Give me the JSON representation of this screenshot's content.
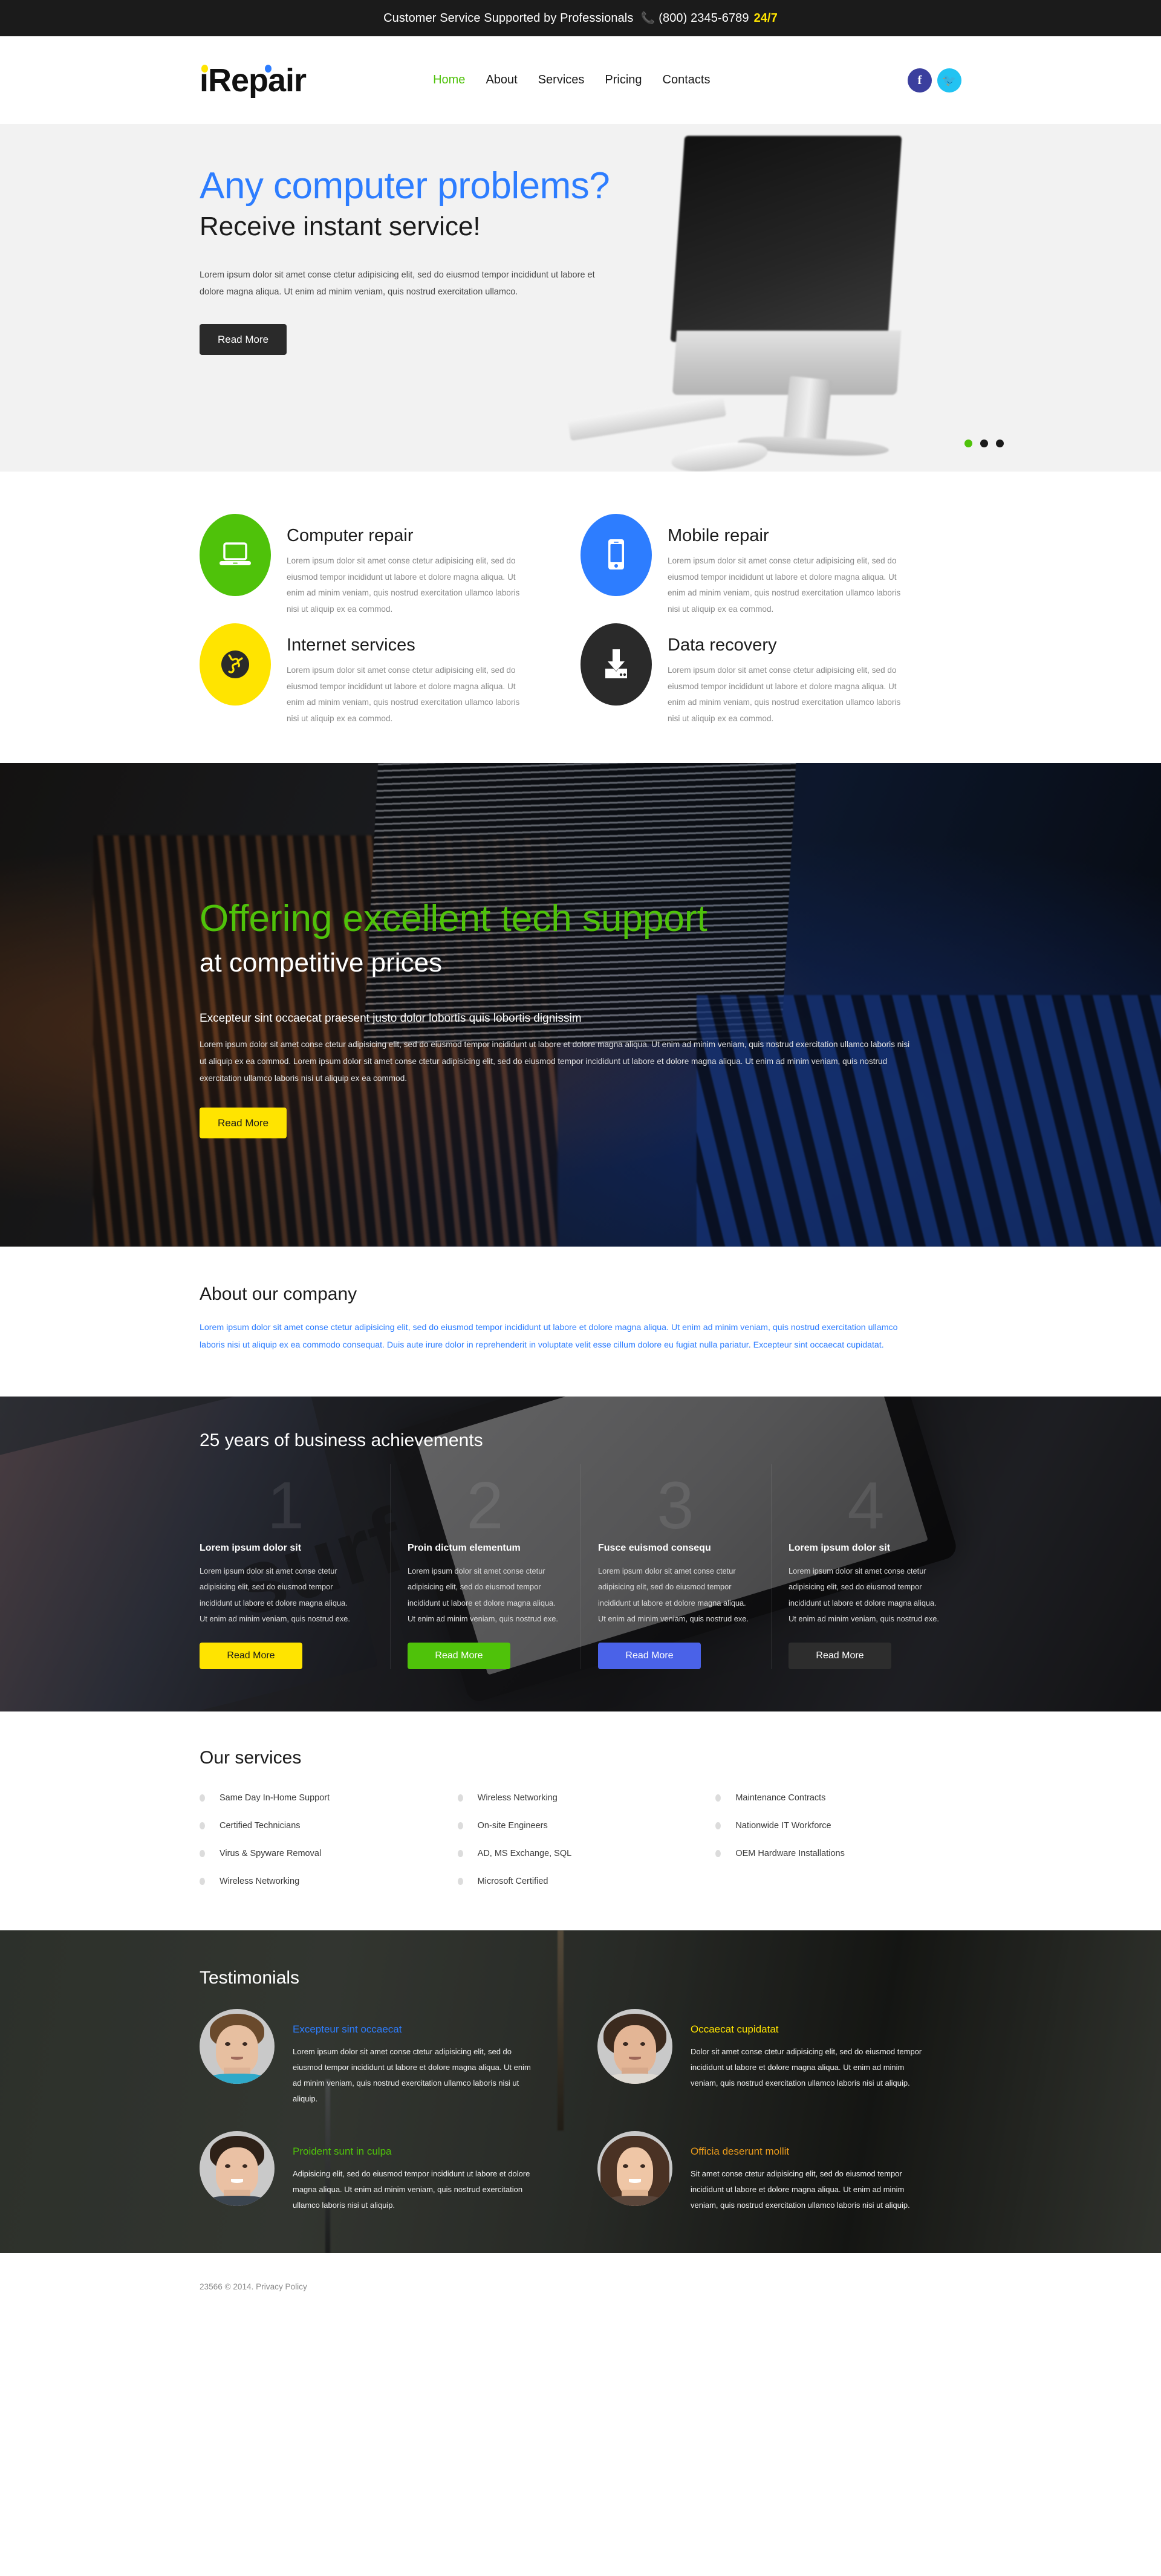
{
  "topbar": {
    "text": "Customer Service Supported by Professionals",
    "phone_icon": "phone-icon",
    "phone": "(800) 2345-6789",
    "badge": "24/7"
  },
  "header": {
    "logo": "iRepair",
    "nav": [
      {
        "label": "Home",
        "active": true
      },
      {
        "label": "About",
        "active": false
      },
      {
        "label": "Services",
        "active": false
      },
      {
        "label": "Pricing",
        "active": false
      },
      {
        "label": "Contacts",
        "active": false
      }
    ],
    "socials": [
      {
        "name": "facebook-icon",
        "glyph": "f"
      },
      {
        "name": "twitter-icon",
        "glyph": "🐦"
      }
    ]
  },
  "hero": {
    "title": "Any computer problems?",
    "subtitle": "Receive instant service!",
    "paragraph": "Lorem ipsum dolor sit amet conse ctetur adipisicing elit, sed do eiusmod tempor incididunt ut labore et dolore magna aliqua. Ut enim ad minim veniam, quis nostrud exercitation ullamco.",
    "button": "Read More",
    "dots_total": 3,
    "dot_active_index": 0
  },
  "features": [
    {
      "icon": "laptop-icon",
      "color": "#4fc20a",
      "title": "Computer repair",
      "text": "Lorem ipsum dolor sit amet conse ctetur adipisicing elit, sed do eiusmod tempor incididunt ut labore et dolore magna aliqua. Ut enim ad minim veniam, quis nostrud exercitation ullamco laboris nisi ut aliquip ex ea commod."
    },
    {
      "icon": "smartphone-icon",
      "color": "#2d7dff",
      "title": "Mobile repair",
      "text": "Lorem ipsum dolor sit amet conse ctetur adipisicing elit, sed do eiusmod tempor incididunt ut labore et dolore magna aliqua. Ut enim ad minim veniam, quis nostrud exercitation ullamco laboris nisi ut aliquip ex ea commod."
    },
    {
      "icon": "globe-icon",
      "color": "#ffe400",
      "title": "Internet services",
      "text": "Lorem ipsum dolor sit amet conse ctetur adipisicing elit, sed do eiusmod tempor incididunt ut labore et dolore magna aliqua. Ut enim ad minim veniam, quis nostrud exercitation ullamco laboris nisi ut aliquip ex ea commod."
    },
    {
      "icon": "download-box-icon",
      "color": "#2a2a2a",
      "title": "Data recovery",
      "text": "Lorem ipsum dolor sit amet conse ctetur adipisicing elit, sed do eiusmod tempor incididunt ut labore et dolore magna aliqua. Ut enim ad minim veniam, quis nostrud exercitation ullamco laboris nisi ut aliquip ex ea commod."
    }
  ],
  "promo": {
    "title": "Offering excellent tech support",
    "subtitle": "at competitive prices",
    "lead": "Excepteur sint occaecat praesent justo dolor lobortis quis lobortis dignissim",
    "paragraph": "Lorem ipsum dolor sit amet conse ctetur adipisicing elit, sed do eiusmod tempor incididunt ut labore et dolore magna aliqua. Ut enim ad minim veniam, quis nostrud exercitation ullamco laboris nisi ut aliquip ex ea commod. Lorem ipsum dolor sit amet conse ctetur adipisicing elit, sed do eiusmod tempor incididunt ut labore et dolore magna aliqua. Ut enim ad minim veniam, quis nostrud exercitation ullamco laboris nisi ut aliquip ex ea commod.",
    "button": "Read More"
  },
  "about": {
    "title": "About our company",
    "paragraph": "Lorem ipsum dolor sit amet conse ctetur adipisicing elit, sed do eiusmod tempor incididunt ut labore et dolore magna aliqua. Ut enim ad minim veniam, quis nostrud exercitation ullamco laboris nisi ut aliquip ex ea commodo consequat. Duis aute irure dolor in reprehenderit in voluptate velit esse cillum dolore eu fugiat nulla pariatur. Excepteur sint occaecat cupidatat."
  },
  "achievements": {
    "title": "25 years of business achievements",
    "watermark": "surf",
    "cards": [
      {
        "number": "1",
        "title": "Lorem ipsum dolor sit",
        "text": "Lorem ipsum dolor sit amet conse ctetur adipisicing elit, sed do eiusmod tempor incididunt ut labore et dolore magna aliqua. Ut enim ad minim veniam, quis nostrud exe.",
        "button": "Read More",
        "button_color": "#ffe400"
      },
      {
        "number": "2",
        "title": "Proin dictum elementum",
        "text": "Lorem ipsum dolor sit amet conse ctetur adipisicing elit, sed do eiusmod tempor incididunt ut labore et dolore magna aliqua. Ut enim ad minim veniam, quis nostrud exe.",
        "button": "Read More",
        "button_color": "#4fc20a"
      },
      {
        "number": "3",
        "title": "Fusce euismod consequ",
        "text": "Lorem ipsum dolor sit amet conse ctetur adipisicing elit, sed do eiusmod tempor incididunt ut labore et dolore magna aliqua. Ut enim ad minim veniam, quis nostrud exe.",
        "button": "Read More",
        "button_color": "#4a62e8"
      },
      {
        "number": "4",
        "title": "Lorem ipsum dolor sit",
        "text": "Lorem ipsum dolor sit amet conse ctetur adipisicing elit, sed do eiusmod tempor incididunt ut labore et dolore magna aliqua. Ut enim ad minim veniam, quis nostrud exe.",
        "button": "Read More",
        "button_color": "#2d2d2d"
      }
    ]
  },
  "services": {
    "title": "Our services",
    "columns": [
      [
        "Same Day In-Home Support",
        "Certified Technicians",
        "Virus & Spyware Removal",
        "Wireless Networking"
      ],
      [
        "Wireless Networking",
        "On-site Engineers",
        "AD, MS Exchange, SQL",
        "Microsoft Certified"
      ],
      [
        "Maintenance Contracts",
        "Nationwide IT Workforce",
        "OEM Hardware Installations"
      ]
    ]
  },
  "testimonials": {
    "title": "Testimonials",
    "items": [
      {
        "avatar": "avatar-man-curly",
        "heading": "Excepteur sint occaecat",
        "heading_color": "#2d7dff",
        "text": "Lorem ipsum dolor sit amet conse ctetur adipisicing elit, sed do eiusmod tempor incididunt ut labore et dolore magna aliqua. Ut enim ad minim veniam, quis nostrud exercitation ullamco laboris nisi ut aliquip."
      },
      {
        "avatar": "avatar-man-long-hair",
        "heading": "Occaecat cupidatat",
        "heading_color": "#ffe400",
        "text": "Dolor sit amet conse ctetur adipisicing elit, sed do eiusmod tempor incididunt ut labore et dolore magna aliqua. Ut enim ad minim veniam, quis nostrud exercitation ullamco laboris nisi ut aliquip."
      },
      {
        "avatar": "avatar-man-smiling",
        "heading": "Proident sunt in culpa",
        "heading_color": "#4fc20a",
        "text": "Adipisicing elit, sed do eiusmod tempor incididunt ut labore et dolore magna aliqua. Ut enim ad minim veniam, quis nostrud exercitation ullamco laboris nisi ut aliquip."
      },
      {
        "avatar": "avatar-woman",
        "heading": "Officia deserunt mollit",
        "heading_color": "#e89a1c",
        "text": "Sit amet conse ctetur adipisicing elit, sed do eiusmod tempor incididunt ut labore et dolore magna aliqua. Ut enim ad minim veniam, quis nostrud exercitation ullamco laboris nisi ut aliquip."
      }
    ]
  },
  "footer": {
    "copyright": "23566 © 2014.",
    "privacy_link": "Privacy Policy"
  }
}
